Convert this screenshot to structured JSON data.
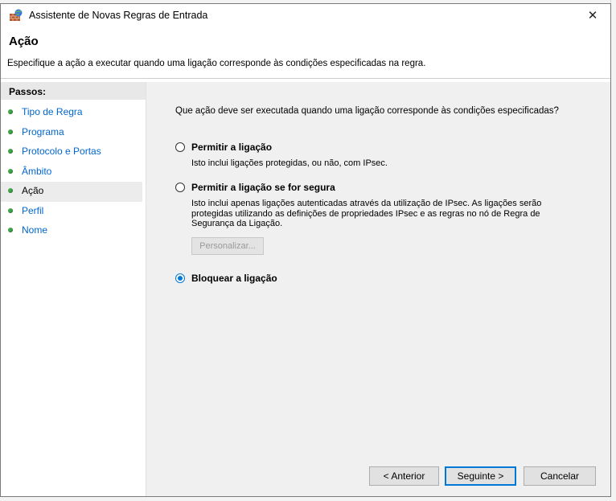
{
  "window": {
    "title": "Assistente de Novas Regras de Entrada",
    "close_glyph": "✕"
  },
  "header": {
    "title": "Ação",
    "description": "Especifique a ação a executar quando uma ligação corresponde às condições especificadas na regra."
  },
  "sidebar": {
    "heading": "Passos:",
    "items": [
      {
        "label": "Tipo de Regra"
      },
      {
        "label": "Programa"
      },
      {
        "label": "Protocolo e Portas"
      },
      {
        "label": "Âmbito"
      },
      {
        "label": "Ação"
      },
      {
        "label": "Perfil"
      },
      {
        "label": "Nome"
      }
    ],
    "current_index": 4
  },
  "main": {
    "question": "Que ação deve ser executada quando uma ligação corresponde às condições especificadas?",
    "options": [
      {
        "label": "Permitir a ligação",
        "description": "Isto inclui ligações protegidas, ou não, com IPsec.",
        "selected": false
      },
      {
        "label": "Permitir a ligação se for segura",
        "description": "Isto inclui apenas ligações autenticadas através da utilização de IPsec. As ligações serão protegidas utilizando as definições de propriedades IPsec e as regras no nó de Regra de Segurança da Ligação.",
        "selected": false
      },
      {
        "label": "Bloquear a ligação",
        "description": "",
        "selected": true
      }
    ],
    "customize_button": "Personalizar..."
  },
  "footer": {
    "back_label": "< Anterior",
    "next_label": "Seguinte >",
    "cancel_label": "Cancelar"
  },
  "colors": {
    "accent": "#0078d7",
    "link": "#0066cc",
    "step_dot": "#3fa64a"
  }
}
